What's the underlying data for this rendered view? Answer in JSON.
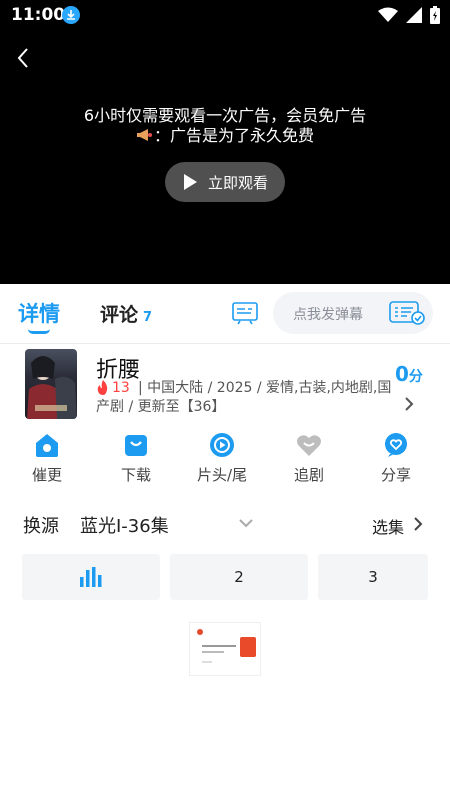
{
  "status_bar": {
    "time": "11:00"
  },
  "player": {
    "ad_notice_line1": "6小时仅需要观看一次广告，会员免广告",
    "ad_notice_line2": "：广告是为了永久免费",
    "play_button_label": "立即观看"
  },
  "tabs": {
    "detail_label": "详情",
    "comments_label": "评论",
    "comments_count": "7",
    "danmaku_placeholder": "点我发弹幕"
  },
  "show": {
    "title": "折腰",
    "heat": "13",
    "meta": " | 中国大陆 / 2025 / 爱情,古装,内地剧,国产剧 / 更新至【36】",
    "score_value": "0",
    "score_unit": "分"
  },
  "actions": [
    {
      "label": "催更",
      "icon": "home-bell-icon"
    },
    {
      "label": "下载",
      "icon": "download-bag-icon"
    },
    {
      "label": "片头/尾",
      "icon": "play-circle-icon"
    },
    {
      "label": "追剧",
      "icon": "heart-icon"
    },
    {
      "label": "分享",
      "icon": "share-heart-icon"
    }
  ],
  "source": {
    "label": "换源",
    "value": "蓝光I-36集",
    "select_episodes": "选集"
  },
  "episodes": {
    "items": [
      "2",
      "3"
    ],
    "playing_icon": "playing-bars-icon"
  },
  "colors": {
    "accent": "#1c9bf0",
    "player_bg": "#000000",
    "heat": "#ff4040"
  }
}
